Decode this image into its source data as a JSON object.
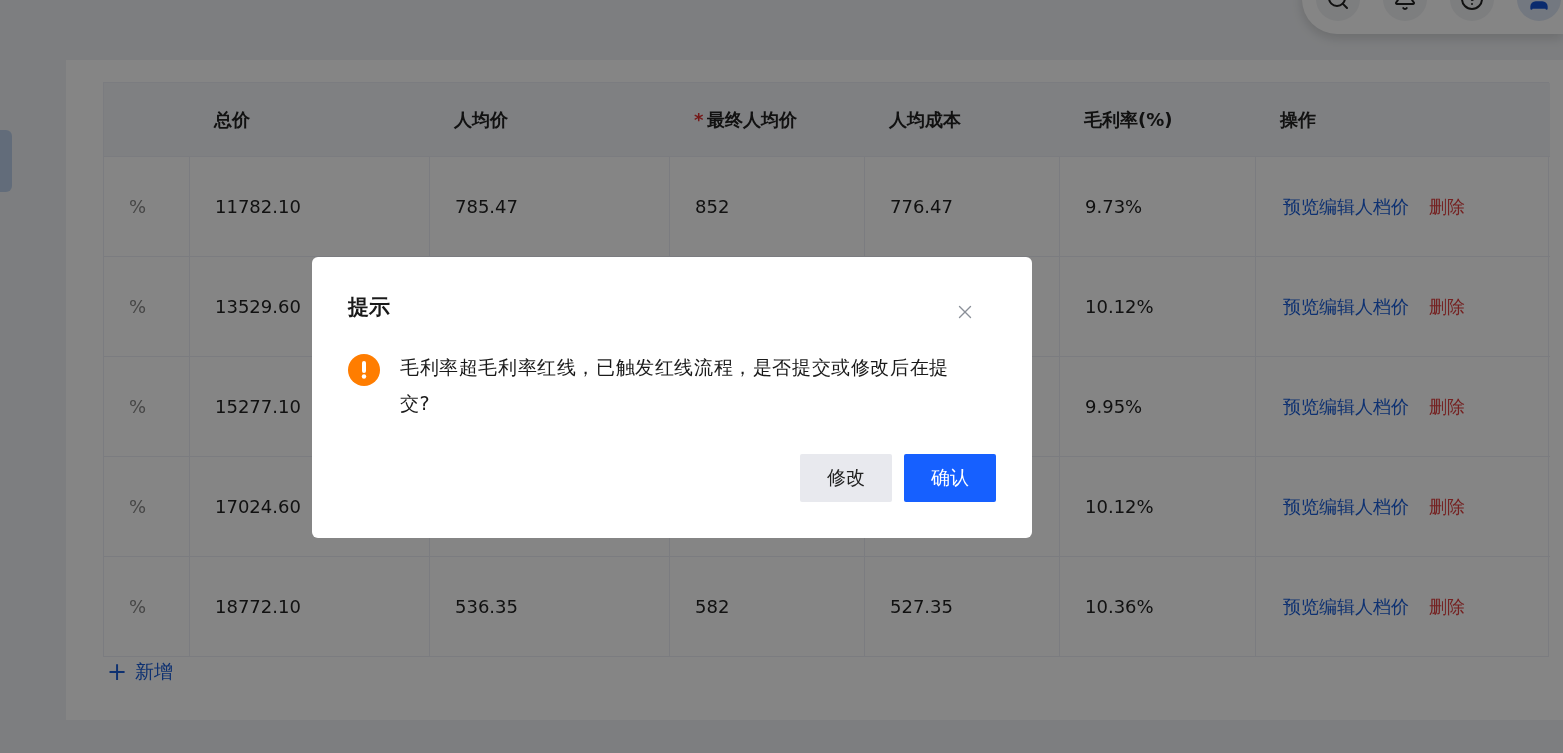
{
  "toolbar": {
    "icons": [
      {
        "kind": "search"
      },
      {
        "kind": "bell"
      },
      {
        "kind": "help"
      },
      {
        "kind": "avatar"
      }
    ]
  },
  "table": {
    "columns": [
      {},
      {
        "label": "总价"
      },
      {
        "label": "人均价"
      },
      {
        "label": "最终人均价",
        "required_mark": "*"
      },
      {
        "label": "人均成本"
      },
      {
        "label": "毛利率(%)"
      },
      {
        "label": "操作"
      }
    ],
    "rows": [
      {
        "cells": [
          "%",
          "11782.10",
          "785.47",
          "852",
          "776.47",
          "9.73%"
        ],
        "actions": [
          {
            "label": "预览编辑人档价",
            "kind": "link"
          },
          {
            "label": "删除",
            "kind": "danger"
          }
        ]
      },
      {
        "cells": [
          "%",
          "13529.60",
          null,
          null,
          null,
          "10.12%"
        ],
        "actions": [
          {
            "label": "预览编辑人档价",
            "kind": "link"
          },
          {
            "label": "删除",
            "kind": "danger"
          }
        ]
      },
      {
        "cells": [
          "%",
          "15277.10",
          null,
          null,
          null,
          "9.95%"
        ],
        "actions": [
          {
            "label": "预览编辑人档价",
            "kind": "link"
          },
          {
            "label": "删除",
            "kind": "danger"
          }
        ]
      },
      {
        "cells": [
          "%",
          "17024.60",
          null,
          null,
          null,
          "10.12%"
        ],
        "actions": [
          {
            "label": "预览编辑人档价",
            "kind": "link"
          },
          {
            "label": "删除",
            "kind": "danger"
          }
        ]
      },
      {
        "cells": [
          "%",
          "18772.10",
          "536.35",
          "582",
          "527.35",
          "10.36%"
        ],
        "actions": [
          {
            "label": "预览编辑人档价",
            "kind": "link"
          },
          {
            "label": "删除",
            "kind": "danger"
          }
        ]
      }
    ],
    "add_button": {
      "icon": "+",
      "label": "新增"
    }
  },
  "dialog": {
    "title": "提示",
    "message": "毛利率超毛利率红线，已触发红线流程，是否提交或修改后在提交?",
    "buttons": [
      {
        "label": "修改",
        "kind": "secondary"
      },
      {
        "label": "确认",
        "kind": "primary"
      }
    ]
  }
}
